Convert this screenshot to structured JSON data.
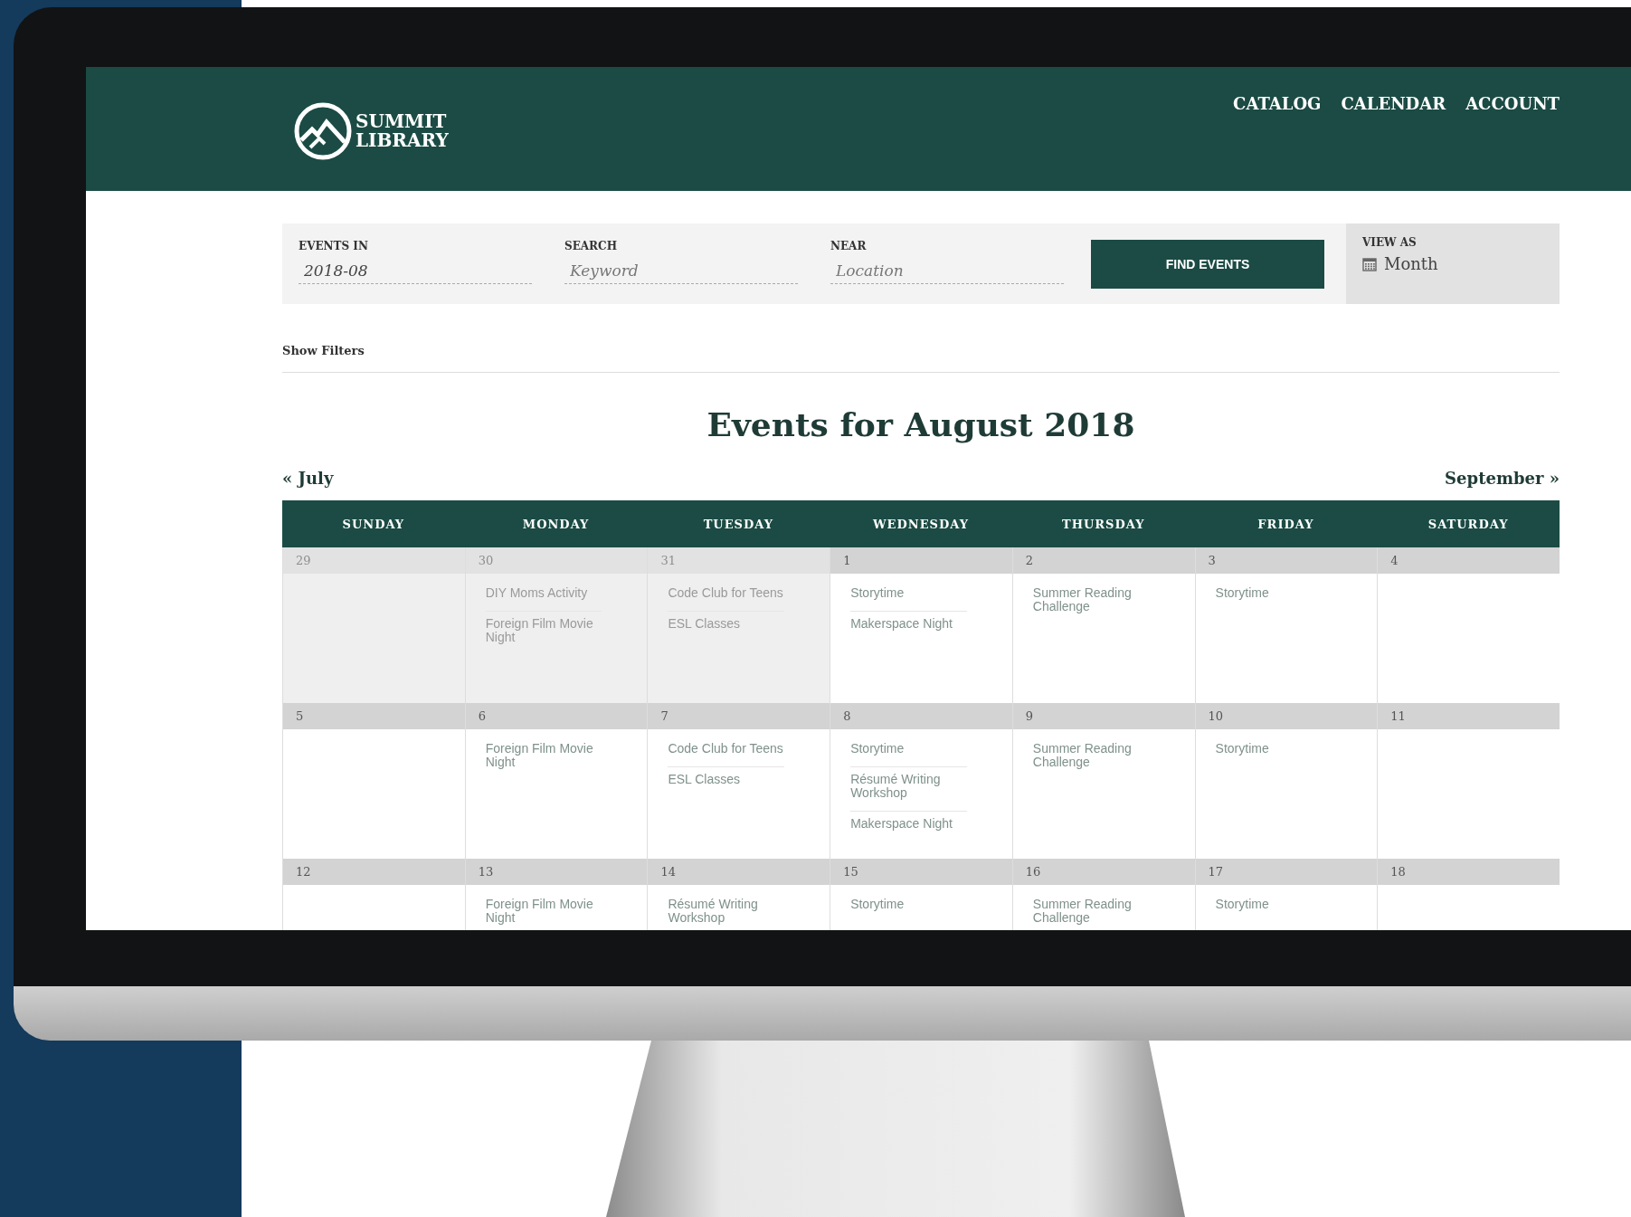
{
  "site": {
    "logo_lines": [
      "SUMMIT",
      "LIBRARY"
    ],
    "nav": [
      "CATALOG",
      "CALENDAR",
      "ACCOUNT"
    ]
  },
  "search_bar": {
    "fields": [
      {
        "label": "EVENTS IN",
        "value": "2018-08"
      },
      {
        "label": "SEARCH",
        "placeholder": "Keyword"
      },
      {
        "label": "NEAR",
        "placeholder": "Location"
      }
    ],
    "button": "FIND EVENTS",
    "view_as": {
      "label": "VIEW AS",
      "value": "Month"
    }
  },
  "filters_link": "Show Filters",
  "title": "Events for August 2018",
  "prev_month": "« July",
  "next_month": "September »",
  "calendar": {
    "weekdays": [
      "SUNDAY",
      "MONDAY",
      "TUESDAY",
      "WEDNESDAY",
      "THURSDAY",
      "FRIDAY",
      "SATURDAY"
    ],
    "weeks": [
      {
        "days": [
          {
            "date": "29",
            "outside_month": true
          },
          {
            "date": "30",
            "outside_month": true,
            "events": [
              "DIY Moms Activity",
              "Foreign Film Movie Night"
            ]
          },
          {
            "date": "31",
            "outside_month": true,
            "events": [
              "Code Club for Teens",
              "ESL Classes"
            ]
          },
          {
            "date": "1",
            "outside_month": false,
            "events": [
              "Storytime",
              "Makerspace Night"
            ]
          },
          {
            "date": "2",
            "outside_month": false,
            "events": [
              "Summer Reading Challenge"
            ]
          },
          {
            "date": "3",
            "outside_month": false,
            "events": [
              "Storytime"
            ]
          },
          {
            "date": "4",
            "outside_month": false
          }
        ]
      },
      {
        "days": [
          {
            "date": "5",
            "outside_month": false
          },
          {
            "date": "6",
            "outside_month": false,
            "events": [
              "Foreign Film Movie Night"
            ]
          },
          {
            "date": "7",
            "outside_month": false,
            "events": [
              "Code Club for Teens",
              "ESL Classes"
            ]
          },
          {
            "date": "8",
            "outside_month": false,
            "events": [
              "Storytime",
              "Résumé Writing Workshop",
              "Makerspace Night"
            ]
          },
          {
            "date": "9",
            "outside_month": false,
            "events": [
              "Summer Reading Challenge"
            ]
          },
          {
            "date": "10",
            "outside_month": false,
            "events": [
              "Storytime"
            ]
          },
          {
            "date": "11",
            "outside_month": false
          }
        ]
      },
      {
        "days": [
          {
            "date": "12",
            "outside_month": false
          },
          {
            "date": "13",
            "outside_month": false,
            "events": [
              "Foreign Film Movie Night"
            ]
          },
          {
            "date": "14",
            "outside_month": false,
            "events": [
              "Résumé Writing Workshop"
            ]
          },
          {
            "date": "15",
            "outside_month": false,
            "events": [
              "Storytime"
            ]
          },
          {
            "date": "16",
            "outside_month": false,
            "events": [
              "Summer Reading Challenge"
            ]
          },
          {
            "date": "17",
            "outside_month": false,
            "events": [
              "Storytime"
            ]
          },
          {
            "date": "18",
            "outside_month": false
          }
        ]
      }
    ]
  }
}
